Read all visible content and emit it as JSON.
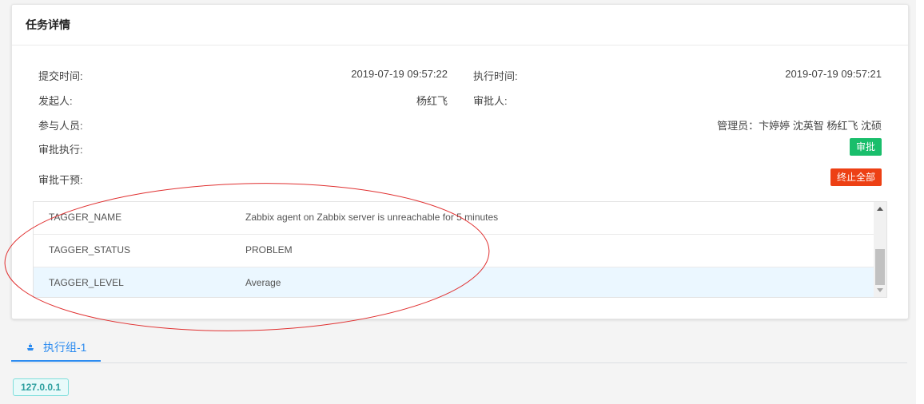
{
  "panel": {
    "title": "任务详情"
  },
  "info": {
    "submit_time_label": "提交时间:",
    "submit_time_value": "2019-07-19 09:57:22",
    "exec_time_label": "执行时间:",
    "exec_time_value": "2019-07-19 09:57:21",
    "initiator_label": "发起人:",
    "initiator_value": "杨红飞",
    "approver_label": "审批人:",
    "approver_value": "",
    "participants_label": "参与人员:",
    "participants_value": "管理员：卞婷婷 沈英智 杨红飞 沈硕",
    "approval_exec_label": "审批执行:",
    "approve_button": "审批",
    "approval_intervene_label": "审批干预:",
    "terminate_all_button": "终止全部"
  },
  "table": {
    "rows": [
      {
        "key": "TAGGER_NAME",
        "value": "Zabbix agent on Zabbix server is unreachable for 5 minutes"
      },
      {
        "key": "TAGGER_STATUS",
        "value": "PROBLEM"
      },
      {
        "key": "TAGGER_LEVEL",
        "value": "Average"
      }
    ]
  },
  "tabs": [
    {
      "label": "执行组-1",
      "icon": "ship-icon"
    }
  ],
  "hosts": [
    "127.0.0.1"
  ],
  "colors": {
    "approve": "#19be6b",
    "terminate": "#ed4014",
    "tab_active": "#2d8cf0",
    "annotation_ellipse": "#e03030",
    "row_highlight": "#ebf7ff"
  }
}
